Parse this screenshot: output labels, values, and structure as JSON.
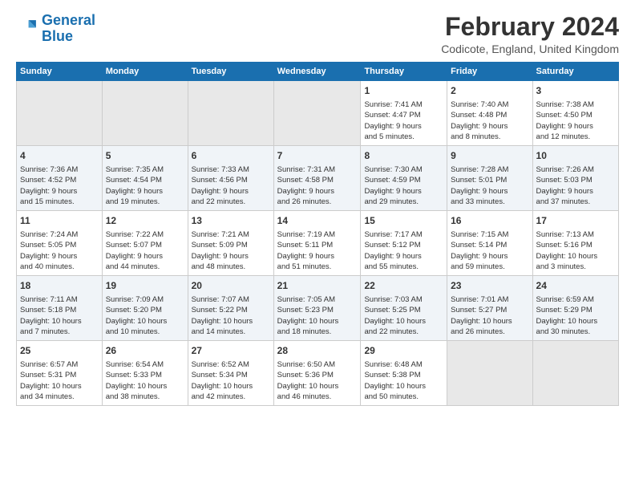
{
  "logo": {
    "line1": "General",
    "line2": "Blue"
  },
  "title": "February 2024",
  "subtitle": "Codicote, England, United Kingdom",
  "headers": [
    "Sunday",
    "Monday",
    "Tuesday",
    "Wednesday",
    "Thursday",
    "Friday",
    "Saturday"
  ],
  "weeks": [
    [
      {
        "day": "",
        "content": ""
      },
      {
        "day": "",
        "content": ""
      },
      {
        "day": "",
        "content": ""
      },
      {
        "day": "",
        "content": ""
      },
      {
        "day": "1",
        "content": "Sunrise: 7:41 AM\nSunset: 4:47 PM\nDaylight: 9 hours\nand 5 minutes."
      },
      {
        "day": "2",
        "content": "Sunrise: 7:40 AM\nSunset: 4:48 PM\nDaylight: 9 hours\nand 8 minutes."
      },
      {
        "day": "3",
        "content": "Sunrise: 7:38 AM\nSunset: 4:50 PM\nDaylight: 9 hours\nand 12 minutes."
      }
    ],
    [
      {
        "day": "4",
        "content": "Sunrise: 7:36 AM\nSunset: 4:52 PM\nDaylight: 9 hours\nand 15 minutes."
      },
      {
        "day": "5",
        "content": "Sunrise: 7:35 AM\nSunset: 4:54 PM\nDaylight: 9 hours\nand 19 minutes."
      },
      {
        "day": "6",
        "content": "Sunrise: 7:33 AM\nSunset: 4:56 PM\nDaylight: 9 hours\nand 22 minutes."
      },
      {
        "day": "7",
        "content": "Sunrise: 7:31 AM\nSunset: 4:58 PM\nDaylight: 9 hours\nand 26 minutes."
      },
      {
        "day": "8",
        "content": "Sunrise: 7:30 AM\nSunset: 4:59 PM\nDaylight: 9 hours\nand 29 minutes."
      },
      {
        "day": "9",
        "content": "Sunrise: 7:28 AM\nSunset: 5:01 PM\nDaylight: 9 hours\nand 33 minutes."
      },
      {
        "day": "10",
        "content": "Sunrise: 7:26 AM\nSunset: 5:03 PM\nDaylight: 9 hours\nand 37 minutes."
      }
    ],
    [
      {
        "day": "11",
        "content": "Sunrise: 7:24 AM\nSunset: 5:05 PM\nDaylight: 9 hours\nand 40 minutes."
      },
      {
        "day": "12",
        "content": "Sunrise: 7:22 AM\nSunset: 5:07 PM\nDaylight: 9 hours\nand 44 minutes."
      },
      {
        "day": "13",
        "content": "Sunrise: 7:21 AM\nSunset: 5:09 PM\nDaylight: 9 hours\nand 48 minutes."
      },
      {
        "day": "14",
        "content": "Sunrise: 7:19 AM\nSunset: 5:11 PM\nDaylight: 9 hours\nand 51 minutes."
      },
      {
        "day": "15",
        "content": "Sunrise: 7:17 AM\nSunset: 5:12 PM\nDaylight: 9 hours\nand 55 minutes."
      },
      {
        "day": "16",
        "content": "Sunrise: 7:15 AM\nSunset: 5:14 PM\nDaylight: 9 hours\nand 59 minutes."
      },
      {
        "day": "17",
        "content": "Sunrise: 7:13 AM\nSunset: 5:16 PM\nDaylight: 10 hours\nand 3 minutes."
      }
    ],
    [
      {
        "day": "18",
        "content": "Sunrise: 7:11 AM\nSunset: 5:18 PM\nDaylight: 10 hours\nand 7 minutes."
      },
      {
        "day": "19",
        "content": "Sunrise: 7:09 AM\nSunset: 5:20 PM\nDaylight: 10 hours\nand 10 minutes."
      },
      {
        "day": "20",
        "content": "Sunrise: 7:07 AM\nSunset: 5:22 PM\nDaylight: 10 hours\nand 14 minutes."
      },
      {
        "day": "21",
        "content": "Sunrise: 7:05 AM\nSunset: 5:23 PM\nDaylight: 10 hours\nand 18 minutes."
      },
      {
        "day": "22",
        "content": "Sunrise: 7:03 AM\nSunset: 5:25 PM\nDaylight: 10 hours\nand 22 minutes."
      },
      {
        "day": "23",
        "content": "Sunrise: 7:01 AM\nSunset: 5:27 PM\nDaylight: 10 hours\nand 26 minutes."
      },
      {
        "day": "24",
        "content": "Sunrise: 6:59 AM\nSunset: 5:29 PM\nDaylight: 10 hours\nand 30 minutes."
      }
    ],
    [
      {
        "day": "25",
        "content": "Sunrise: 6:57 AM\nSunset: 5:31 PM\nDaylight: 10 hours\nand 34 minutes."
      },
      {
        "day": "26",
        "content": "Sunrise: 6:54 AM\nSunset: 5:33 PM\nDaylight: 10 hours\nand 38 minutes."
      },
      {
        "day": "27",
        "content": "Sunrise: 6:52 AM\nSunset: 5:34 PM\nDaylight: 10 hours\nand 42 minutes."
      },
      {
        "day": "28",
        "content": "Sunrise: 6:50 AM\nSunset: 5:36 PM\nDaylight: 10 hours\nand 46 minutes."
      },
      {
        "day": "29",
        "content": "Sunrise: 6:48 AM\nSunset: 5:38 PM\nDaylight: 10 hours\nand 50 minutes."
      },
      {
        "day": "",
        "content": ""
      },
      {
        "day": "",
        "content": ""
      }
    ]
  ]
}
